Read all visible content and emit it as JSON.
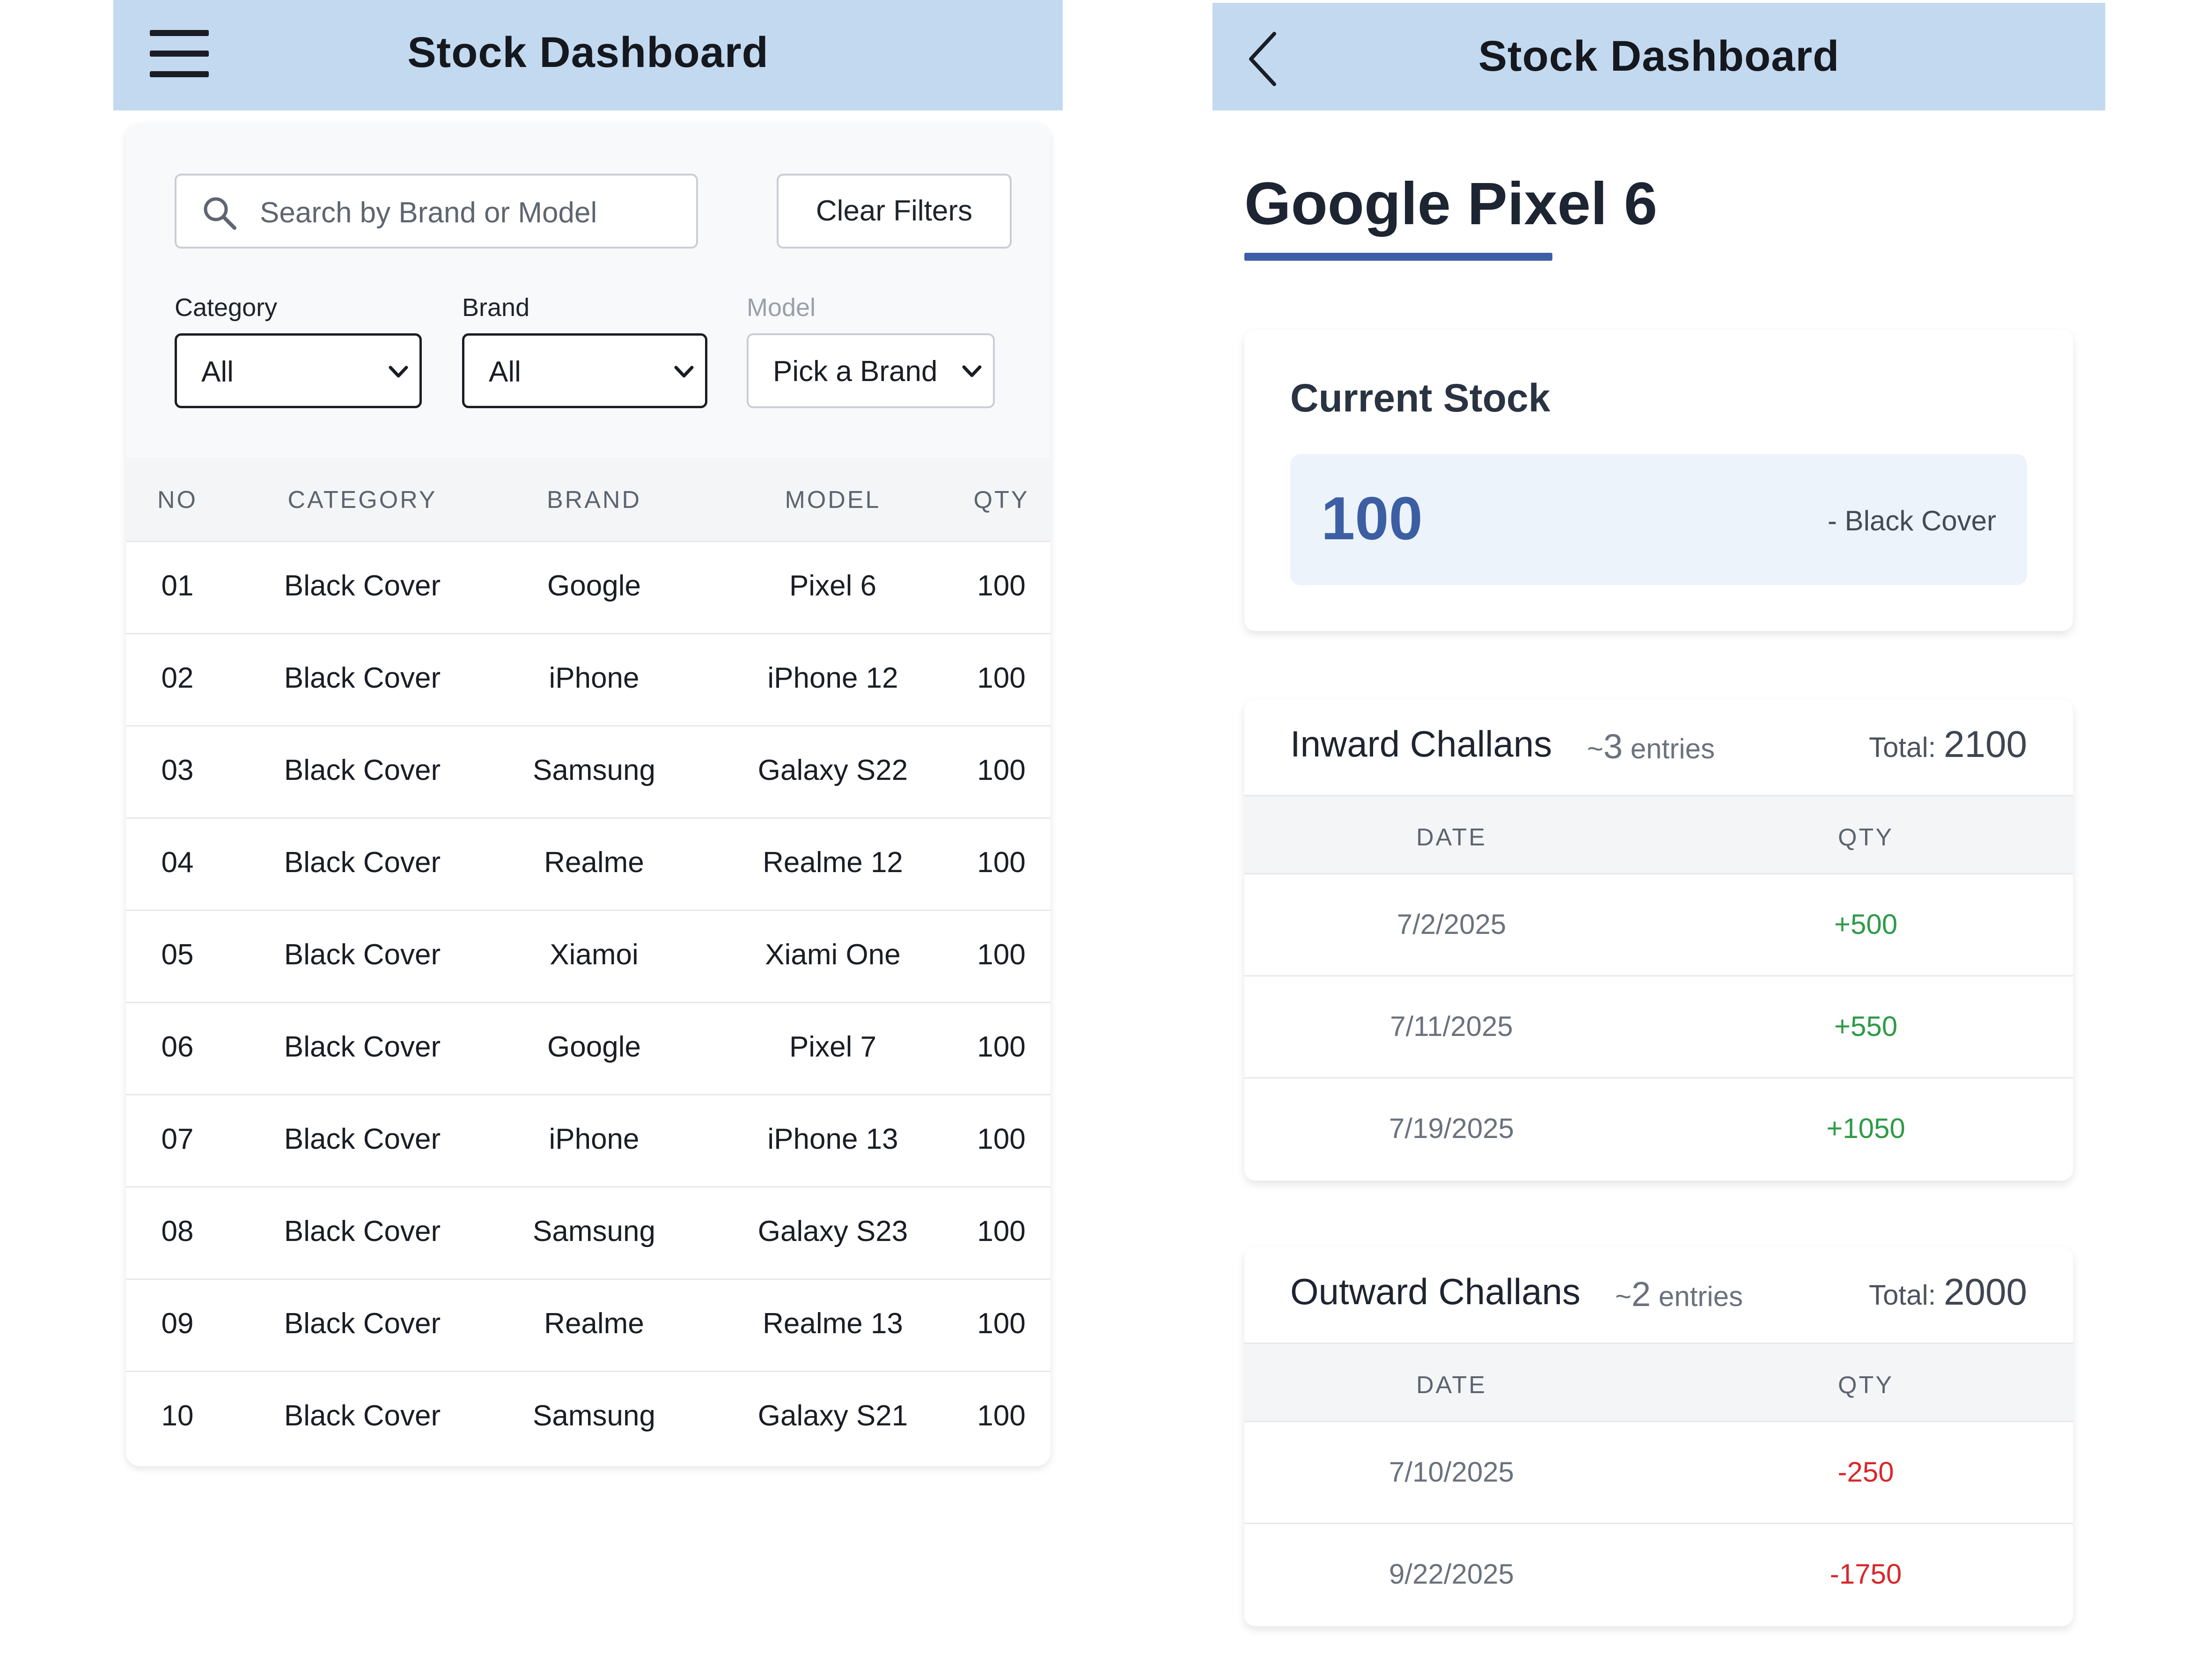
{
  "left": {
    "header": {
      "title": "Stock Dashboard",
      "menu_icon": "hamburger-menu-icon"
    },
    "search": {
      "placeholder": "Search by Brand or Model",
      "icon": "search-icon"
    },
    "clear_filters_label": "Clear Filters",
    "filters": {
      "category": {
        "label": "Category",
        "value": "All"
      },
      "brand": {
        "label": "Brand",
        "value": "All"
      },
      "model": {
        "label": "Model",
        "value": "Pick a Brand"
      }
    },
    "table": {
      "headers": [
        "NO",
        "CATEGORY",
        "BRAND",
        "MODEL",
        "QTY"
      ],
      "rows": [
        {
          "no": "01",
          "category": "Black Cover",
          "brand": "Google",
          "model": "Pixel 6",
          "qty": "100"
        },
        {
          "no": "02",
          "category": "Black Cover",
          "brand": "iPhone",
          "model": "iPhone 12",
          "qty": "100"
        },
        {
          "no": "03",
          "category": "Black Cover",
          "brand": "Samsung",
          "model": "Galaxy S22",
          "qty": "100"
        },
        {
          "no": "04",
          "category": "Black Cover",
          "brand": "Realme",
          "model": "Realme 12",
          "qty": "100"
        },
        {
          "no": "05",
          "category": "Black Cover",
          "brand": "Xiamoi",
          "model": "Xiami One",
          "qty": "100"
        },
        {
          "no": "06",
          "category": "Black Cover",
          "brand": "Google",
          "model": "Pixel 7",
          "qty": "100"
        },
        {
          "no": "07",
          "category": "Black Cover",
          "brand": "iPhone",
          "model": "iPhone 13",
          "qty": "100"
        },
        {
          "no": "08",
          "category": "Black Cover",
          "brand": "Samsung",
          "model": "Galaxy S23",
          "qty": "100"
        },
        {
          "no": "09",
          "category": "Black Cover",
          "brand": "Realme",
          "model": "Realme 13",
          "qty": "100"
        },
        {
          "no": "10",
          "category": "Black Cover",
          "brand": "Samsung",
          "model": "Galaxy S21",
          "qty": "100"
        }
      ]
    }
  },
  "right": {
    "header": {
      "title": "Stock Dashboard",
      "back_icon": "back-arrow-icon"
    },
    "product_title": "Google Pixel 6",
    "current_stock": {
      "heading": "Current Stock",
      "value": "100",
      "label": "- Black Cover"
    },
    "inward": {
      "title": "Inward Challans",
      "entries_prefix": "~",
      "entries_count": "3",
      "entries_word": "entries",
      "total_label": "Total:",
      "total_value": "2100",
      "headers": [
        "DATE",
        "QTY"
      ],
      "rows": [
        {
          "date": "7/2/2025",
          "qty": "+500"
        },
        {
          "date": "7/11/2025",
          "qty": "+550"
        },
        {
          "date": "7/19/2025",
          "qty": "+1050"
        }
      ]
    },
    "outward": {
      "title": "Outward Challans",
      "entries_prefix": "~",
      "entries_count": "2",
      "entries_word": "entries",
      "total_label": "Total:",
      "total_value": "2000",
      "headers": [
        "DATE",
        "QTY"
      ],
      "rows": [
        {
          "date": "7/10/2025",
          "qty": "-250"
        },
        {
          "date": "9/22/2025",
          "qty": "-1750"
        }
      ]
    }
  },
  "colors": {
    "header_bg": "#c2d9f0",
    "accent_blue": "#3d5fa6",
    "positive": "#2e9a48",
    "negative": "#d9262b"
  }
}
